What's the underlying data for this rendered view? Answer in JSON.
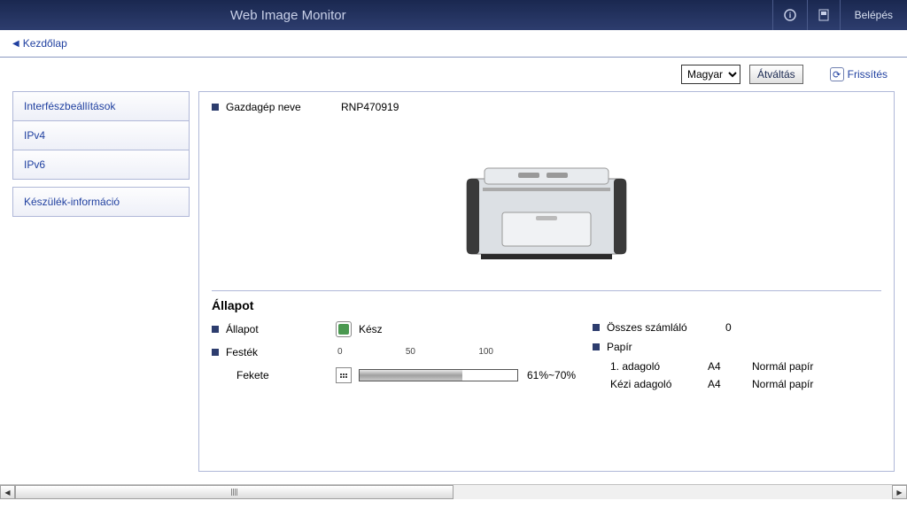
{
  "header": {
    "title": "Web Image Monitor",
    "login_label": "Belépés"
  },
  "breadcrumb": {
    "home": "Kezdőlap"
  },
  "toolbar": {
    "language_selected": "Magyar",
    "switch_label": "Átváltás",
    "refresh_label": "Frissítés"
  },
  "sidebar": {
    "group1": [
      {
        "label": "Interfészbeállítások"
      },
      {
        "label": "IPv4"
      },
      {
        "label": "IPv6"
      }
    ],
    "group2": [
      {
        "label": "Készülék-információ"
      }
    ]
  },
  "hostinfo": {
    "label": "Gazdagép neve",
    "value": "RNP470919"
  },
  "status": {
    "section_title": "Állapot",
    "status_label": "Állapot",
    "status_value": "Kész",
    "toner_label": "Festék",
    "toner_black_label": "Fekete",
    "toner_scale": {
      "min": "0",
      "mid": "50",
      "max": "100"
    },
    "toner_percent_text": "61%~70%",
    "toner_fill_percent": 65,
    "counter_label": "Összes számláló",
    "counter_value": "0",
    "paper_label": "Papír",
    "trays": [
      {
        "name": "1. adagoló",
        "size": "A4",
        "type": "Normál papír"
      },
      {
        "name": "Kézi adagoló",
        "size": "A4",
        "type": "Normál papír"
      }
    ]
  }
}
